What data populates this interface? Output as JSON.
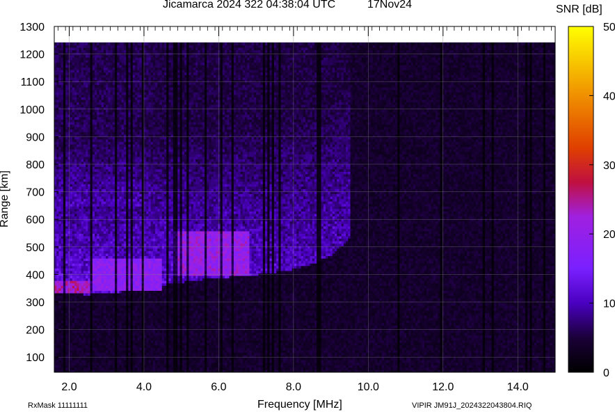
{
  "title": "Jicamarca 2024 322 04:38:04 UTC",
  "date": "17Nov24",
  "colorbar": {
    "label": "SNR [dB]",
    "ticks": [
      0,
      10,
      20,
      30,
      40,
      50
    ],
    "range": [
      0,
      50
    ],
    "colors": [
      "#000000",
      "#2a0060",
      "#5a18ff",
      "#9a18ff",
      "#c0105a",
      "#e04000",
      "#f09000",
      "#ffff00"
    ]
  },
  "footer_left": "RxMask 11111111",
  "footer_right": "VIPIR  JM91J_2024322043804.RIQ",
  "chart_data": {
    "type": "heatmap",
    "title": "Jicamarca 2024 322 04:38:04 UTC",
    "xlabel": "Frequency [MHz]",
    "ylabel": "Range [km]",
    "xlim": [
      1.6,
      15.0
    ],
    "ylim": [
      45,
      1300
    ],
    "xticks": [
      2.0,
      4.0,
      6.0,
      8.0,
      10.0,
      12.0,
      14.0
    ],
    "xtick_labels": [
      "2.0",
      "4.0",
      "6.0",
      "8.0",
      "10.0",
      "12.0",
      "14.0"
    ],
    "yticks": [
      100,
      200,
      300,
      400,
      500,
      600,
      700,
      800,
      900,
      1000,
      1100,
      1200,
      1300
    ],
    "grid": true,
    "data_range_max_km": 1240,
    "colorbar": {
      "label": "SNR [dB]",
      "range": [
        0,
        50
      ]
    },
    "ionogram_trace": {
      "description_series": "Lower edge of F-region echo",
      "x_mhz": [
        1.6,
        2.0,
        2.5,
        3.0,
        3.5,
        4.0,
        4.5,
        5.0,
        5.5,
        6.0,
        6.5,
        7.0,
        7.5,
        8.0,
        8.5,
        9.0,
        9.5
      ],
      "virtual_height_km": [
        330,
        330,
        328,
        330,
        340,
        350,
        362,
        372,
        382,
        388,
        395,
        400,
        408,
        420,
        440,
        470,
        530
      ]
    },
    "high_snr_regions": [
      {
        "x_range_mhz": [
          1.6,
          2.6
        ],
        "range_km": [
          330,
          380
        ],
        "snr_db": 25
      },
      {
        "x_range_mhz": [
          2.6,
          4.5
        ],
        "range_km": [
          340,
          460
        ],
        "snr_db": 20
      },
      {
        "x_range_mhz": [
          4.8,
          6.8
        ],
        "range_km": [
          400,
          560
        ],
        "snr_db": 22
      }
    ]
  }
}
